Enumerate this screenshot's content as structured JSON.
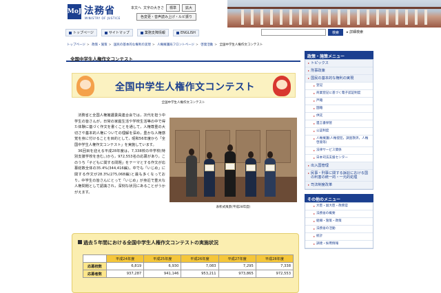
{
  "header": {
    "logo_mark": "MoJ",
    "site_name": "法務省",
    "site_name_en": "MINISTRY OF JUSTICE",
    "home_link": "本文へ",
    "font_size_label": "文字の大きさ",
    "font_standard": "標準",
    "font_large": "拡大",
    "color_change": "色変更・音声読み上げ・ルビ振り"
  },
  "nav": {
    "items": [
      "トップページ",
      "サイトマップ",
      "業務支障情報",
      "ENGLISH"
    ],
    "search_button": "検索",
    "advanced_search": "詳細検索"
  },
  "breadcrumb": [
    "トップページ",
    "政策・施策",
    "国民の基本的な権利の実現",
    "人権擁護局フロントページ",
    "啓発活動",
    "全国中学生人権作文コンテスト"
  ],
  "main": {
    "page_title": "全国中学生人権作文コンテスト",
    "banner_title": "全国中学生人権作文コンテスト",
    "banner_caption": "全国中学生人権作文コンテスト",
    "paragraph1": "法務省と全国人権擁護委員連合会では，次代を担う中学生の皆さんが，日常の家庭生活や学校生活等の中で得た体験に基づく作文を書くことを通して，人権尊重の大切さや基本的人権についての理解を深め，豊かな人権感覚を身に付けることを目的として，昭和56年度から「全国中学生人権作文コンテスト」を実施しています。",
    "paragraph2": "36回目を迎える平成28年度は，7,338校の中学校(特別支援学校を含む。)から，972,553名の応募があり，このうち「子どもに関する問題」をテーマとする作文が応募総数全体の35.4%(344,416編)，中でも「いじめ」に関する作文が28.3%(275,068編)と最も多くなっており，中学生の皆さんにとって「いじめ」が身近で重大な人権問題として認識され，深刻な状況にあることがうかがえます。",
    "photo_caption": "表彰式風景(平成28年度)"
  },
  "stats": {
    "title": "過去５年間における全国中学生人権作文コンテストの実施状況",
    "columns": [
      "平成24年度",
      "平成25年度",
      "平成26年度",
      "平成27年度",
      "平成28年度"
    ],
    "rows": [
      {
        "label": "応募校数",
        "values": [
          "6,819",
          "6,930",
          "7,083",
          "7,295",
          "7,338"
        ]
      },
      {
        "label": "応募者数",
        "values": [
          "937,287",
          "941,146",
          "953,211",
          "973,865",
          "972,553"
        ]
      }
    ]
  },
  "sidebar": {
    "heading1": "政策・施策メニュー",
    "items": [
      {
        "label": "トピックス",
        "level": "top"
      },
      {
        "label": "刑事政策",
        "level": "top"
      },
      {
        "label": "国民の基本的な権利の実現",
        "level": "top"
      },
      {
        "label": "登記",
        "level": "sub"
      },
      {
        "label": "商業登記に基づく電子認証制度",
        "level": "sub"
      },
      {
        "label": "戸籍",
        "level": "sub"
      },
      {
        "label": "国籍",
        "level": "sub"
      },
      {
        "label": "供託",
        "level": "sub"
      },
      {
        "label": "遺言書保管",
        "level": "sub"
      },
      {
        "label": "公証制度",
        "level": "sub"
      },
      {
        "label": "人権擁護(人権侵犯，調査救済，人権啓発等)",
        "level": "sub"
      },
      {
        "label": "法律サービス関係",
        "level": "sub"
      },
      {
        "label": "日本司法支援センター",
        "level": "sub"
      },
      {
        "label": "出入国管理",
        "level": "top"
      },
      {
        "label": "民事・刑事に関する訴訟における国の利害の統一的・一元的処理",
        "level": "top"
      },
      {
        "label": "司法制度改革",
        "level": "top"
      }
    ],
    "heading2": "その他のメニュー",
    "items2": [
      "大臣・副大臣・政務官",
      "法務省の概要",
      "組織・施策・政策",
      "法務省の活動",
      "統計",
      "調達・採用情報"
    ]
  }
}
